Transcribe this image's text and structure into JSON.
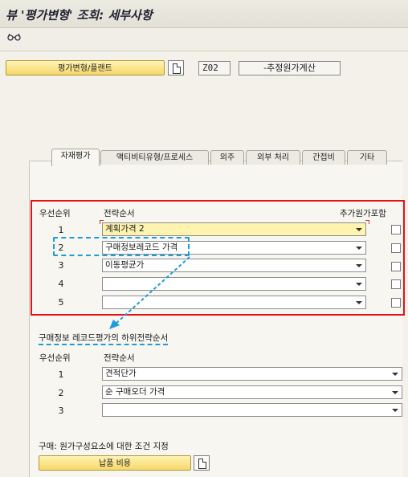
{
  "window": {
    "title": "뷰 '평가변형' 조회: 세부사항"
  },
  "toolbar": {
    "icon": "glasses-icon"
  },
  "header": {
    "variant_button": "평가변형/플랜트",
    "code": "Z02",
    "code_description": "-추정원가계산"
  },
  "tabs": [
    {
      "label": "자재평가",
      "active": true
    },
    {
      "label": "액티비티유형/프로세스",
      "active": false
    },
    {
      "label": "외주",
      "active": false
    },
    {
      "label": "외부 처리",
      "active": false
    },
    {
      "label": "간접비",
      "active": false
    },
    {
      "label": "기타",
      "active": false
    }
  ],
  "strategy": {
    "col_priority": "우선순위",
    "col_sequence": "전략순서",
    "col_add_cost": "추가원가포함",
    "rows": [
      {
        "priority": "1",
        "value": "계획가격 2",
        "checked": false
      },
      {
        "priority": "2",
        "value": "구매정보레코드 가격",
        "checked": false
      },
      {
        "priority": "3",
        "value": "이동평균가",
        "checked": false
      },
      {
        "priority": "4",
        "value": "",
        "checked": false
      },
      {
        "priority": "5",
        "value": "",
        "checked": false
      }
    ]
  },
  "sub_strategy": {
    "title": "구매정보 레코드평가의 하위전략순서",
    "col_priority": "우선순위",
    "col_sequence": "전략순서",
    "rows": [
      {
        "priority": "1",
        "value": "견적단가"
      },
      {
        "priority": "2",
        "value": "순 구매오더 가격"
      },
      {
        "priority": "3",
        "value": ""
      }
    ]
  },
  "purchasing": {
    "label": "구매: 원가구성요소에 대한 조건 지정",
    "button": "납품 비용"
  },
  "colors": {
    "highlight_red": "#e3121b",
    "annotation_blue": "#1d9bdc",
    "button_yellow": "#f6d76a"
  }
}
